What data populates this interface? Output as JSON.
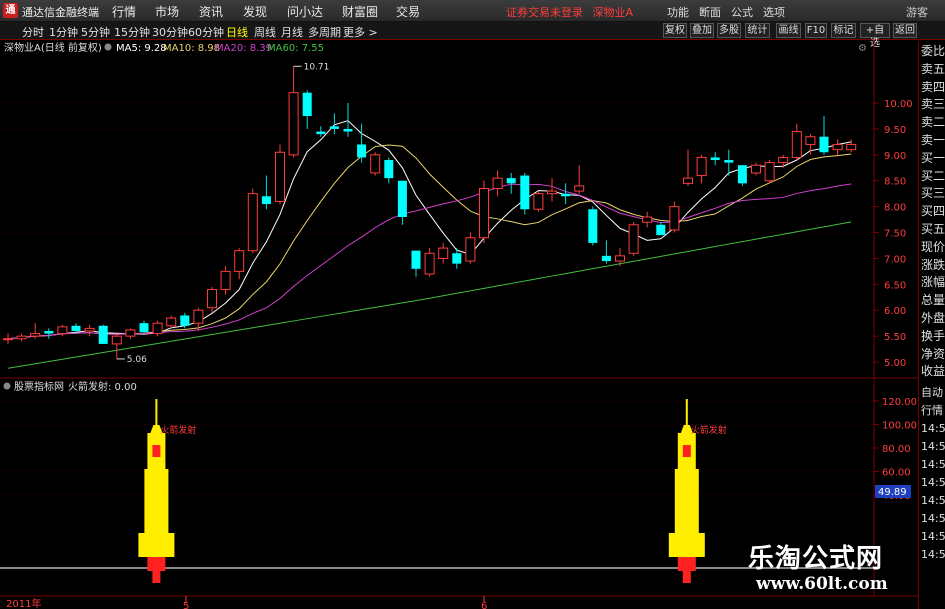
{
  "window": {
    "title": "通达信金融终端",
    "menu": [
      "行情",
      "市场",
      "资讯",
      "发现",
      "问小达",
      "财富圈",
      "交易"
    ],
    "notice": "证券交易未登录",
    "stock_tab": "深物业A",
    "right_menu": [
      "功能",
      "断面",
      "公式",
      "选项"
    ],
    "user": "游客"
  },
  "toolbar": {
    "periods": [
      "分时",
      "1分钟",
      "5分钟",
      "15分钟",
      "30分钟",
      "60分钟",
      "日线",
      "周线",
      "月线",
      "多周期",
      "更多 >"
    ],
    "active_period": "日线",
    "buttons": [
      "复权",
      "叠加",
      "多股",
      "统计",
      "画线",
      "F10",
      "标记",
      "+自选",
      "返回"
    ]
  },
  "main_panel": {
    "header": "深物业A(日线 前复权)",
    "ma": [
      {
        "label": "MA5: 9.28",
        "color": "#ffffff"
      },
      {
        "label": "MA10: 8.98",
        "color": "#e8d46b"
      },
      {
        "label": "MA20: 8.39",
        "color": "#d040d0"
      },
      {
        "label": "MA60: 7.55",
        "color": "#40c040"
      }
    ],
    "price_labels": [
      "10.00",
      "9.50",
      "9.00",
      "8.50",
      "8.00",
      "7.50",
      "7.00",
      "6.50",
      "6.00",
      "5.50",
      "5.00"
    ],
    "high_label": "10.71",
    "low_label": "5.06"
  },
  "sub_panel": {
    "header": "股票指标网",
    "indicator": "火箭发射: 0.00",
    "signal_label": "火箭发射",
    "axis_labels": [
      "120.00",
      "100.00",
      "80.00",
      "60.00",
      "40.00"
    ],
    "current_value": "49.89"
  },
  "right_panel": {
    "items": [
      "委比",
      "卖五",
      "卖四",
      "卖三",
      "卖二",
      "卖一",
      "买一",
      "买二",
      "买三",
      "买四",
      "买五",
      "现价",
      "涨跌",
      "涨幅",
      "总量",
      "外盘",
      "换手",
      "净资",
      "收益"
    ],
    "items2": [
      "自动",
      "行情",
      "14:5",
      "14:5",
      "14:5",
      "14:5",
      "14:5",
      "14:5",
      "14:5",
      "14:5"
    ]
  },
  "time_axis": [
    "2011年",
    "5",
    "6"
  ],
  "watermark": {
    "main": "乐淘公式网",
    "url": "www.60lt.com"
  },
  "chart_data": {
    "type": "candlestick",
    "ohlc": [
      [
        5.45,
        5.55,
        5.35,
        5.45
      ],
      [
        5.45,
        5.55,
        5.4,
        5.5
      ],
      [
        5.5,
        5.75,
        5.45,
        5.55
      ],
      [
        5.6,
        5.65,
        5.45,
        5.55
      ],
      [
        5.55,
        5.72,
        5.5,
        5.68
      ],
      [
        5.7,
        5.75,
        5.55,
        5.6
      ],
      [
        5.6,
        5.72,
        5.5,
        5.65
      ],
      [
        5.7,
        5.72,
        5.35,
        5.35
      ],
      [
        5.35,
        5.55,
        5.06,
        5.5
      ],
      [
        5.5,
        5.65,
        5.45,
        5.62
      ],
      [
        5.75,
        5.8,
        5.55,
        5.58
      ],
      [
        5.55,
        5.8,
        5.5,
        5.75
      ],
      [
        5.7,
        5.9,
        5.65,
        5.85
      ],
      [
        5.9,
        5.95,
        5.65,
        5.7
      ],
      [
        5.75,
        6.05,
        5.6,
        6.0
      ],
      [
        6.05,
        6.45,
        5.95,
        6.4
      ],
      [
        6.4,
        6.85,
        6.3,
        6.75
      ],
      [
        6.75,
        7.2,
        6.6,
        7.15
      ],
      [
        7.15,
        8.35,
        7.1,
        8.25
      ],
      [
        8.2,
        8.6,
        7.95,
        8.05
      ],
      [
        8.1,
        9.2,
        8.05,
        9.05
      ],
      [
        9.0,
        10.71,
        8.95,
        10.2
      ],
      [
        10.2,
        10.25,
        9.5,
        9.75
      ],
      [
        9.45,
        9.55,
        9.35,
        9.4
      ],
      [
        9.55,
        9.8,
        9.4,
        9.5
      ],
      [
        9.5,
        10.0,
        9.35,
        9.45
      ],
      [
        9.2,
        9.6,
        8.85,
        8.95
      ],
      [
        8.65,
        9.05,
        8.6,
        9.0
      ],
      [
        8.9,
        8.95,
        8.45,
        8.55
      ],
      [
        8.5,
        8.5,
        7.65,
        7.8
      ],
      [
        7.15,
        6.9,
        6.65,
        6.8
      ],
      [
        6.7,
        7.2,
        6.65,
        7.1
      ],
      [
        7.0,
        7.3,
        6.9,
        7.2
      ],
      [
        7.1,
        7.2,
        6.8,
        6.9
      ],
      [
        6.95,
        7.5,
        6.9,
        7.4
      ],
      [
        7.4,
        8.5,
        7.3,
        8.35
      ],
      [
        8.35,
        8.7,
        8.2,
        8.55
      ],
      [
        8.55,
        8.65,
        8.25,
        8.45
      ],
      [
        8.6,
        8.65,
        7.85,
        7.95
      ],
      [
        7.95,
        8.3,
        7.9,
        8.25
      ],
      [
        8.25,
        8.55,
        8.1,
        8.3
      ],
      [
        8.25,
        8.45,
        8.05,
        8.2
      ],
      [
        8.3,
        8.8,
        8.25,
        8.4
      ],
      [
        7.95,
        8.0,
        7.25,
        7.3
      ],
      [
        7.05,
        7.35,
        6.9,
        6.95
      ],
      [
        6.95,
        7.2,
        6.85,
        7.05
      ],
      [
        7.1,
        7.7,
        7.05,
        7.65
      ],
      [
        7.7,
        7.9,
        7.6,
        7.8
      ],
      [
        7.65,
        7.7,
        7.45,
        7.45
      ],
      [
        7.55,
        8.1,
        7.5,
        8.0
      ],
      [
        8.45,
        9.1,
        8.4,
        8.55
      ],
      [
        8.6,
        9.0,
        8.45,
        8.95
      ],
      [
        8.95,
        9.05,
        8.8,
        8.9
      ],
      [
        8.9,
        9.1,
        8.6,
        8.85
      ],
      [
        8.8,
        8.8,
        8.4,
        8.45
      ],
      [
        8.65,
        8.85,
        8.6,
        8.8
      ],
      [
        8.5,
        8.9,
        8.45,
        8.85
      ],
      [
        8.85,
        9.0,
        8.75,
        8.95
      ],
      [
        8.95,
        9.6,
        8.9,
        9.45
      ],
      [
        9.2,
        9.4,
        9.0,
        9.35
      ],
      [
        9.35,
        9.75,
        9.0,
        9.05
      ],
      [
        9.1,
        9.3,
        9.0,
        9.2
      ],
      [
        9.1,
        9.3,
        9.05,
        9.2
      ]
    ],
    "price_range": [
      4.75,
      10.85
    ],
    "rocket_signals": [
      9,
      48
    ]
  }
}
